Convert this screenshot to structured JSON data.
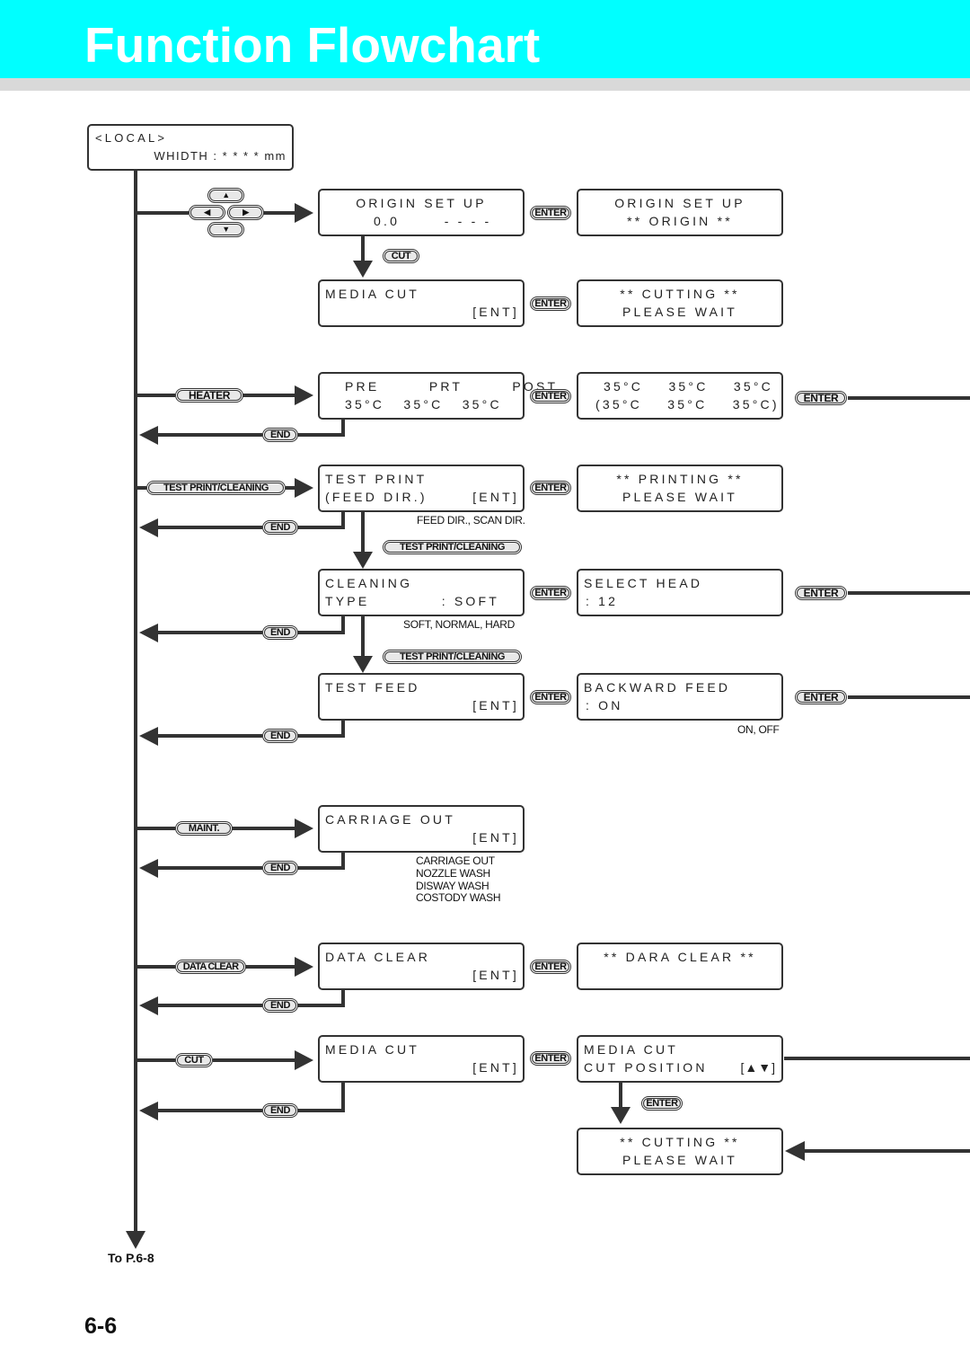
{
  "header": {
    "title": "Function Flowchart",
    "accent_color": "#00ffff"
  },
  "local_display": {
    "line1": "<LOCAL>",
    "line2": "WHIDTH : * * * * mm"
  },
  "keys": {
    "enter": "ENTER",
    "end": "END",
    "cut": "CUT",
    "heater": "HEATER",
    "test_print_cleaning": "TEST PRINT/CLEANING",
    "maint": "MAINT.",
    "data_clear": "DATA CLEAR",
    "arrow_up": "▲",
    "arrow_down": "▼",
    "arrow_left": "◀",
    "arrow_right": "▶"
  },
  "rows": {
    "origin": {
      "screen": {
        "line1": "ORIGIN SET UP",
        "line2": "0.0       - - - -"
      },
      "result": {
        "line1": "ORIGIN SET UP",
        "line2": "** ORIGIN **"
      }
    },
    "media_cut_top": {
      "screen": {
        "line1": "MEDIA CUT",
        "line2": "[ENT]"
      },
      "result": {
        "line1": "** CUTTING **",
        "line2": "PLEASE WAIT"
      }
    },
    "heater": {
      "screen": {
        "line1": "PRE     PRT     POST",
        "line2": "35°C   35°C   35°C"
      },
      "result": {
        "line1": "35°C    35°C    35°C",
        "line2": "(35°C    35°C    35°C)"
      }
    },
    "test_print": {
      "screen": {
        "line1": "TEST PRINT",
        "line2": "(FEED DIR.)",
        "line2_right": "[ENT]"
      },
      "result": {
        "line1": "** PRINTING **",
        "line2": "PLEASE WAIT"
      },
      "note": "FEED DIR., SCAN DIR."
    },
    "cleaning": {
      "screen": {
        "line1": "CLEANING",
        "line2": "TYPE",
        "line2_right": ": SOFT"
      },
      "result": {
        "line1": "SELECT HEAD",
        "line2": ": 12"
      },
      "note": "SOFT, NORMAL, HARD"
    },
    "test_feed": {
      "screen": {
        "line1": "TEST FEED",
        "line2": "[ENT]"
      },
      "result": {
        "line1": "BACKWARD FEED",
        "line2": ": ON"
      },
      "note": "ON, OFF"
    },
    "carriage_out": {
      "screen": {
        "line1": "CARRIAGE OUT",
        "line2": "[ENT]"
      },
      "note_lines": [
        "CARRIAGE OUT",
        "NOZZLE WASH",
        "DISWAY WASH",
        "COSTODY WASH"
      ]
    },
    "data_clear": {
      "screen": {
        "line1": "DATA CLEAR",
        "line2": "[ENT]"
      },
      "result": {
        "line1": "** DARA CLEAR **"
      }
    },
    "media_cut_bottom": {
      "screen": {
        "line1": "MEDIA CUT",
        "line2": "[ENT]"
      },
      "result": {
        "line1": "MEDIA CUT",
        "line2": "CUT POSITION",
        "line2_right": "[▲▼]"
      },
      "final": {
        "line1": "** CUTTING **",
        "line2": "PLEASE WAIT"
      }
    }
  },
  "footer": {
    "to_page": "To P.6-8",
    "page_number": "6-6"
  }
}
